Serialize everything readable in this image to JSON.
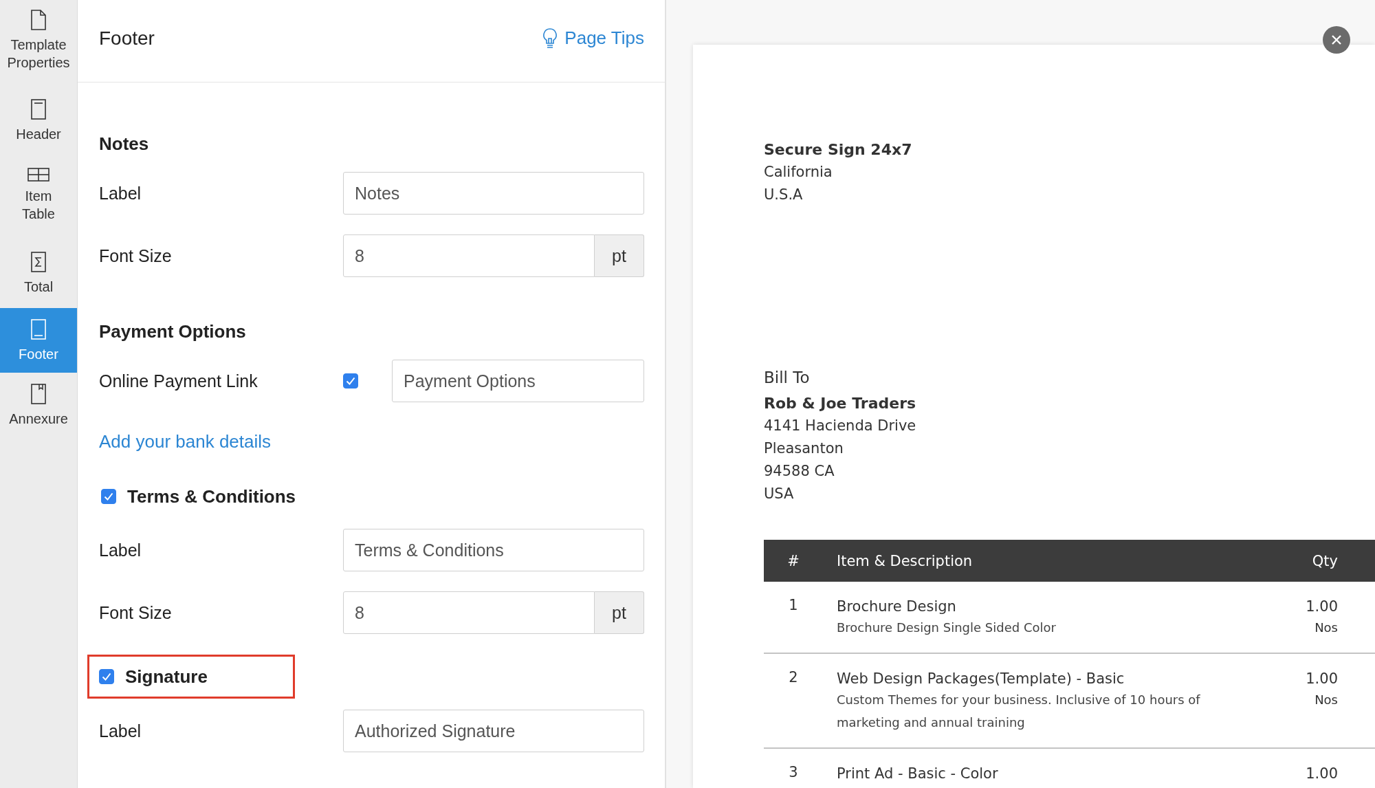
{
  "sidebar": {
    "items": [
      {
        "label": "Template Properties",
        "kind": "page",
        "selected": false
      },
      {
        "label": "Header",
        "kind": "header",
        "selected": false
      },
      {
        "label": "Item Table",
        "kind": "table",
        "selected": false
      },
      {
        "label": "Total",
        "kind": "sum",
        "selected": false
      },
      {
        "label": "Footer",
        "kind": "footer",
        "selected": true
      },
      {
        "label": "Annexure",
        "kind": "bookmark",
        "selected": false
      }
    ]
  },
  "panel": {
    "title": "Footer",
    "page_tips": "Page Tips",
    "rows": [
      {
        "kind": "heading",
        "text": "Notes"
      },
      {
        "kind": "field",
        "label": "Label",
        "value": "Notes"
      },
      {
        "kind": "unit_field",
        "label": "Font Size",
        "value": "8",
        "unit": "pt"
      },
      {
        "kind": "heading",
        "text": "Payment Options"
      },
      {
        "kind": "check_field",
        "label": "Online Payment Link",
        "checked": true,
        "value": "Payment Options"
      },
      {
        "kind": "link",
        "text": "Add your bank details"
      },
      {
        "kind": "check_heading",
        "text": "Terms & Conditions",
        "checked": true,
        "highlighted": false
      },
      {
        "kind": "field",
        "label": "Label",
        "value": "Terms & Conditions"
      },
      {
        "kind": "unit_field",
        "label": "Font Size",
        "value": "8",
        "unit": "pt"
      },
      {
        "kind": "check_heading",
        "text": "Signature",
        "checked": true,
        "highlighted": true
      },
      {
        "kind": "field",
        "label": "Label",
        "value": "Authorized Signature"
      }
    ]
  },
  "preview": {
    "company": {
      "name": "Secure Sign 24x7",
      "lines": [
        "California",
        "U.S.A"
      ]
    },
    "bill_to": {
      "heading": "Bill To",
      "name": "Rob & Joe Traders",
      "lines": [
        "4141 Hacienda Drive",
        "Pleasanton",
        "94588 CA",
        "USA"
      ]
    },
    "table": {
      "columns": [
        "#",
        "Item & Description",
        "Qty"
      ],
      "rows": [
        {
          "number": "1",
          "item": "Brochure Design",
          "description": "Brochure Design Single Sided Color",
          "qty": "1.00",
          "unit": "Nos"
        },
        {
          "number": "2",
          "item": "Web Design Packages(Template) - Basic",
          "description": "Custom Themes for your business. Inclusive of 10 hours of marketing and annual training",
          "qty": "1.00",
          "unit": "Nos"
        },
        {
          "number": "3",
          "item": "Print Ad - Basic - Color",
          "qty": "1.00"
        }
      ]
    }
  }
}
